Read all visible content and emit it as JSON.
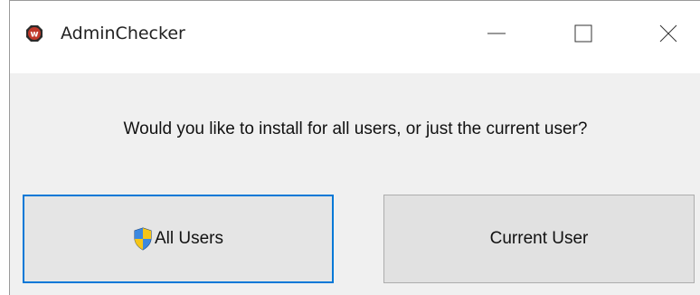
{
  "window": {
    "title": "AdminChecker",
    "app_icon": "w-logo-icon"
  },
  "controls": {
    "minimize_icon": "minimize-icon",
    "maximize_icon": "maximize-icon",
    "close_icon": "close-icon"
  },
  "dialog": {
    "prompt": "Would you like to install for all users, or just the current user?"
  },
  "buttons": {
    "all_users_label": "All Users",
    "all_users_icon": "uac-shield-icon",
    "current_user_label": "Current User"
  },
  "colors": {
    "focus_border": "#0078d7",
    "button_bg": "#e1e1e1",
    "dialog_bg": "#f0f0f0"
  }
}
